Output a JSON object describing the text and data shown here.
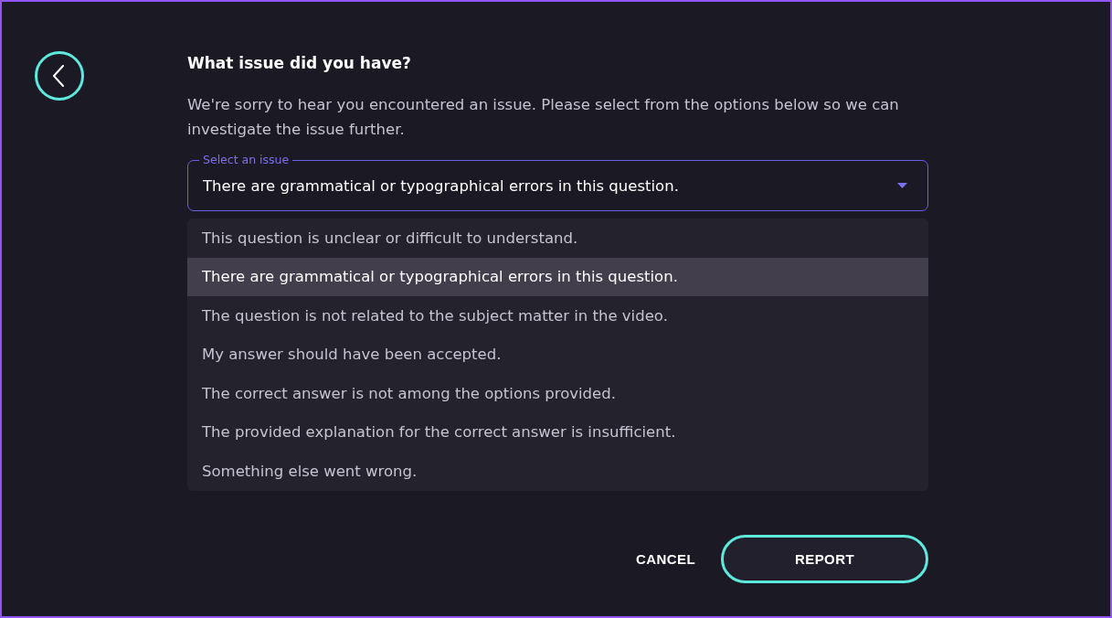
{
  "heading": "What issue did you have?",
  "description": "We're sorry to hear you encountered an issue. Please select from the options below so we can investigate the issue further.",
  "select": {
    "label": "Select an issue",
    "value": "There are grammatical or typographical errors in this question.",
    "expanded": true
  },
  "options": [
    {
      "label": "This question is unclear or difficult to understand.",
      "selected": false
    },
    {
      "label": "There are grammatical or typographical errors in this question.",
      "selected": true
    },
    {
      "label": "The question is not related to the subject matter in the video.",
      "selected": false
    },
    {
      "label": "My answer should have been accepted.",
      "selected": false
    },
    {
      "label": "The correct answer is not among the options provided.",
      "selected": false
    },
    {
      "label": "The provided explanation for the correct answer is insufficient.",
      "selected": false
    },
    {
      "label": "Something else went wrong.",
      "selected": false
    }
  ],
  "buttons": [
    {
      "label": "CANCEL",
      "kind": "text"
    },
    {
      "label": "REPORT",
      "kind": "outlined"
    }
  ]
}
